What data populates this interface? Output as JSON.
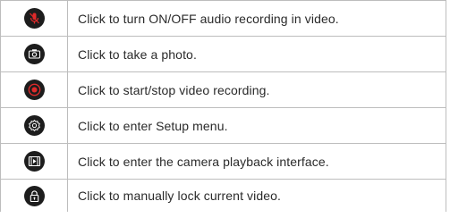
{
  "colors": {
    "icon_background": "#1d1d1d",
    "icon_foreground": "#ffffff",
    "accent_red": "#e02a2a",
    "border": "#bdbdbd",
    "text": "#2a2a2a"
  },
  "rows": [
    {
      "icon": "microphone-off-icon",
      "text": "Click to turn ON/OFF audio recording in video."
    },
    {
      "icon": "camera-icon",
      "text": "Click to take a photo."
    },
    {
      "icon": "record-icon",
      "text": "Click to start/stop video recording."
    },
    {
      "icon": "gear-icon",
      "text": "Click to enter Setup menu."
    },
    {
      "icon": "playback-icon",
      "text": "Click to enter the camera playback interface."
    },
    {
      "icon": "lock-icon",
      "text": "Click to manually lock current video."
    }
  ]
}
